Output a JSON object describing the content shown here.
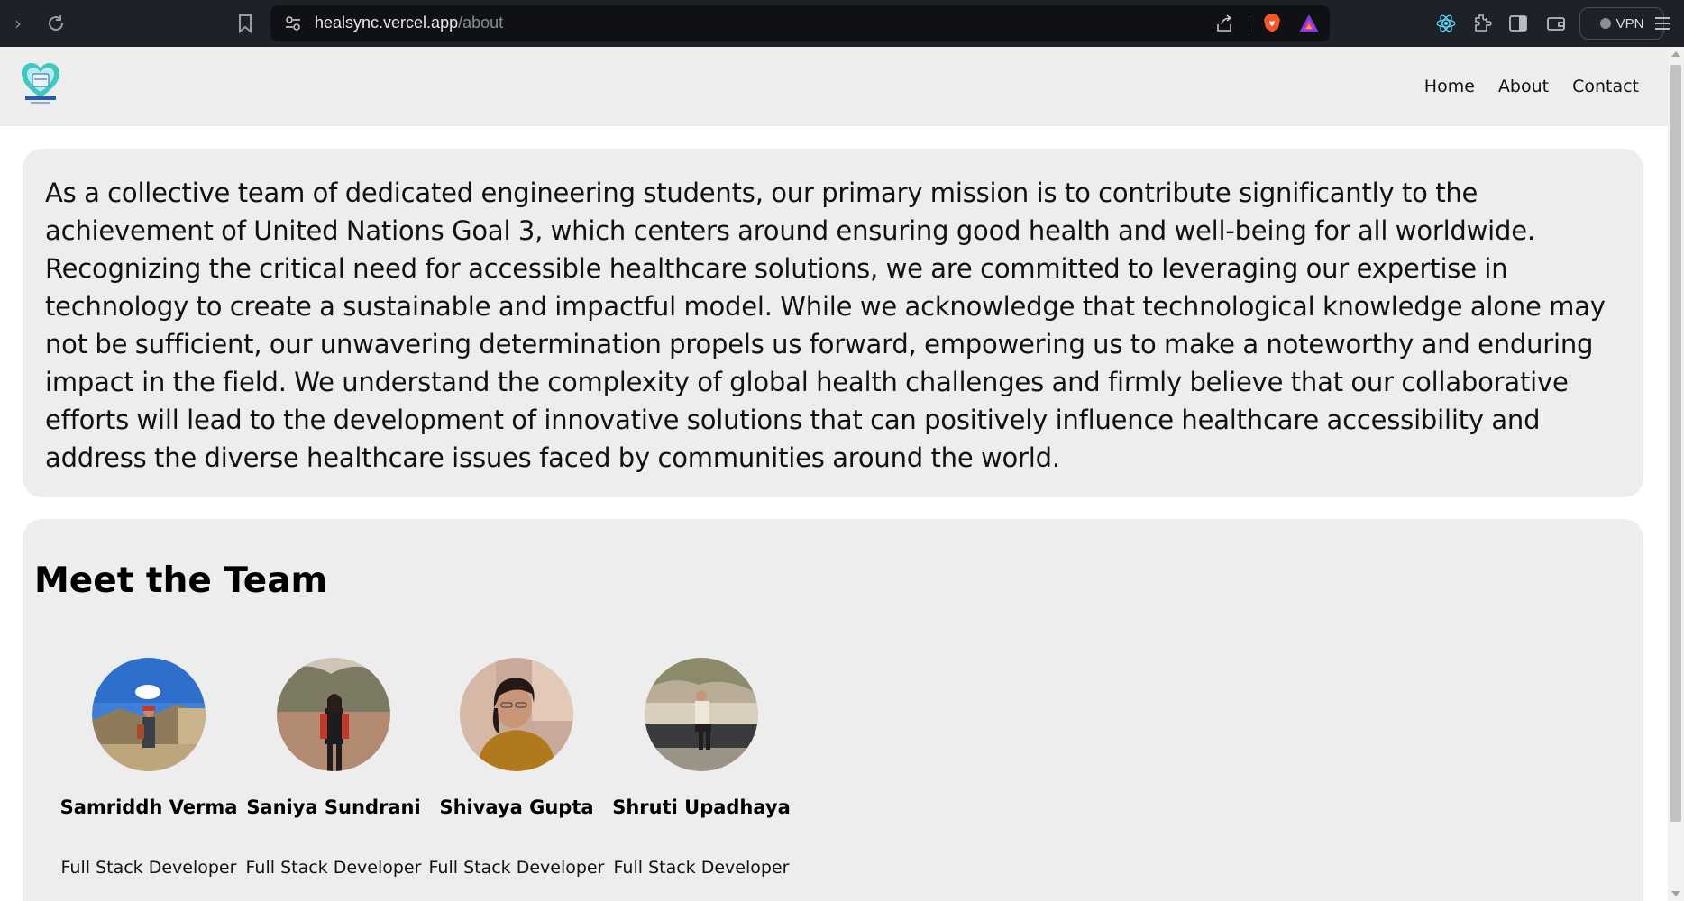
{
  "browser": {
    "url_host": "healsync.vercel.app",
    "url_path": "/about",
    "vpn_label": "VPN"
  },
  "site": {
    "nav": [
      "Home",
      "About",
      "Contact"
    ]
  },
  "mission": {
    "text": "As a collective team of dedicated engineering students, our primary mission is to contribute significantly to the achievement of United Nations Goal 3, which centers around ensuring good health and well-being for all worldwide. Recognizing the critical need for accessible healthcare solutions, we are committed to leveraging our expertise in technology to create a sustainable and impactful model. While we acknowledge that technological knowledge alone may not be sufficient, our unwavering determination propels us forward, empowering us to make a noteworthy and enduring impact in the field. We understand the complexity of global health challenges and firmly believe that our collaborative efforts will lead to the development of innovative solutions that can positively influence healthcare accessibility and address the diverse healthcare issues faced by communities around the world."
  },
  "team": {
    "heading": "Meet the Team",
    "members": [
      {
        "name": "Samriddh Verma",
        "role": "Full Stack Developer"
      },
      {
        "name": "Saniya Sundrani",
        "role": "Full Stack Developer"
      },
      {
        "name": "Shivaya Gupta",
        "role": "Full Stack Developer"
      },
      {
        "name": "Shruti Upadhaya",
        "role": "Full Stack Developer"
      }
    ]
  },
  "colors": {
    "chrome_bg": "#1f2128",
    "card_bg": "#ededed",
    "logo_teal": "#3ec9c0"
  }
}
